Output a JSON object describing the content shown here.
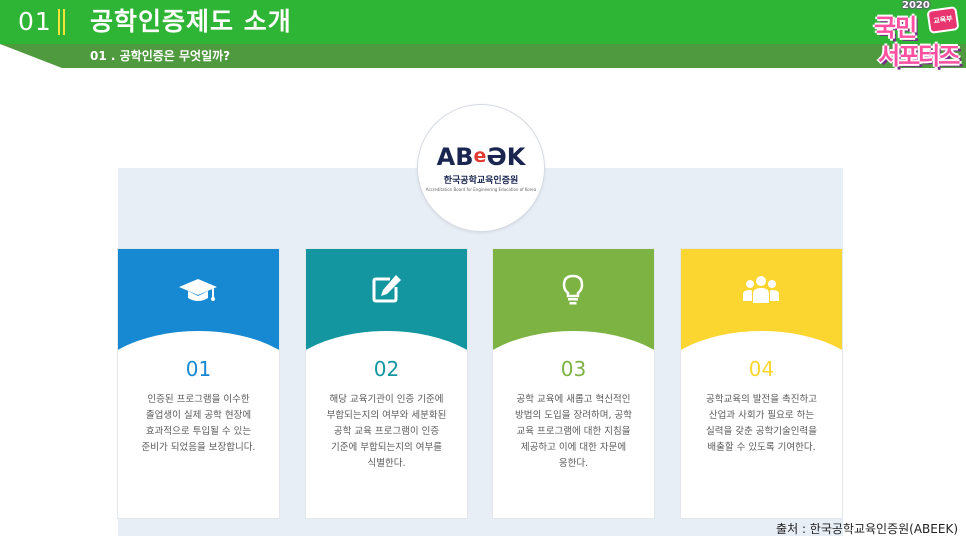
{
  "header": {
    "section_number": "01",
    "title": "공학인증제도 소개",
    "subtitle": "01 . 공학인증은 무엇일까?"
  },
  "badge": {
    "year": "2020",
    "tv_label": "교육부",
    "line1": "국민",
    "line2": "서포터즈"
  },
  "logo": {
    "mark_prefix": "AB",
    "mark_e": "e",
    "mark_suffix": "ƏK",
    "org_name_kor": "한국공학교육인증원",
    "org_name_eng": "Accreditation Board for Engineering Education of Korea"
  },
  "cards": [
    {
      "number": "01",
      "icon": "graduation-cap-icon",
      "color": "#1789d3",
      "text": "인증된 프로그램을 이수한\n졸업생이 실제 공학 현장에\n효과적으로 투입될 수 있는\n준비가 되었음을 보장합니다."
    },
    {
      "number": "02",
      "icon": "edit-icon",
      "color": "#13969f",
      "text": "해당 교육기관이 인증 기준에\n부합되는지의 여부와 세분화된\n공학 교육 프로그램이 인증\n기준에 부합되는지의 여부를\n식별한다."
    },
    {
      "number": "03",
      "icon": "lightbulb-icon",
      "color": "#7db342",
      "text": "공학 교육에 새롭고 혁신적인\n방법의 도입을 장려하며, 공학\n교육 프로그램에 대한 지침을\n제공하고 이에 대한 자문에\n응한다."
    },
    {
      "number": "04",
      "icon": "group-icon",
      "color": "#fbd530",
      "text": "공학교육의 발전을 촉진하고\n산업과 사회가 필요로 하는\n실력을 갖춘 공학기술인력을\n배출할 수 있도록 기여한다."
    }
  ],
  "source": "출처 : 한국공학교육인증원(ABEEK)"
}
